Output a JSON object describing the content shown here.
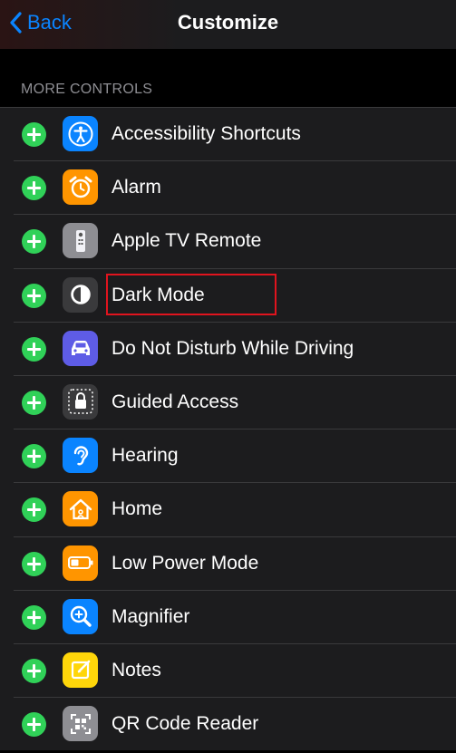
{
  "nav": {
    "back_label": "Back",
    "title": "Customize"
  },
  "section": {
    "header": "MORE CONTROLS"
  },
  "items": [
    {
      "label": "Accessibility Shortcuts",
      "icon": "accessibility-icon",
      "color": "#0a84ff"
    },
    {
      "label": "Alarm",
      "icon": "alarm-clock-icon",
      "color": "#ff9500"
    },
    {
      "label": "Apple TV Remote",
      "icon": "tv-remote-icon",
      "color": "#8e8e93"
    },
    {
      "label": "Dark Mode",
      "icon": "dark-mode-icon",
      "color": "#3a3a3c"
    },
    {
      "label": "Do Not Disturb While Driving",
      "icon": "car-icon",
      "color": "#5e5ce6"
    },
    {
      "label": "Guided Access",
      "icon": "lock-icon",
      "color": "#3a3a3c"
    },
    {
      "label": "Hearing",
      "icon": "ear-icon",
      "color": "#0a84ff"
    },
    {
      "label": "Home",
      "icon": "home-icon",
      "color": "#ff9500"
    },
    {
      "label": "Low Power Mode",
      "icon": "battery-icon",
      "color": "#ff9500"
    },
    {
      "label": "Magnifier",
      "icon": "magnifier-icon",
      "color": "#0a84ff"
    },
    {
      "label": "Notes",
      "icon": "notes-icon",
      "color": "#ffd60a"
    },
    {
      "label": "QR Code Reader",
      "icon": "qr-code-icon",
      "color": "#8e8e93"
    }
  ],
  "colors": {
    "accent": "#0a84ff",
    "add": "#30d158",
    "highlight": "#e0141e"
  }
}
